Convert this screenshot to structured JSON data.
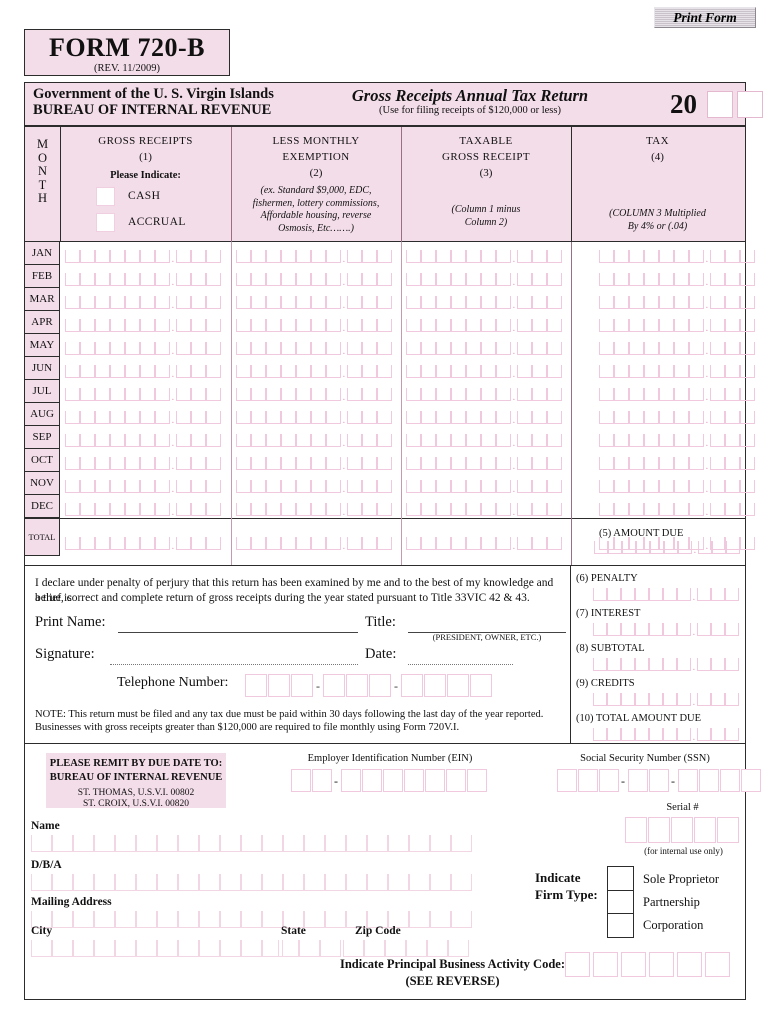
{
  "print_button": {
    "label": "Print Form"
  },
  "form_header": {
    "form_number": "FORM 720-B",
    "revision": "(REV. 11/2009)",
    "government_line": "Government of the U. S.  Virgin Islands",
    "bureau_line": "BUREAU OF INTERNAL REVENUE",
    "return_title": "Gross Receipts Annual Tax Return",
    "return_subtitle": "(Use for filing receipts of $120,000 or less)",
    "year_prefix": "20"
  },
  "columns": {
    "month_header": "M\nO\nN\nT\nH",
    "month_letters": [
      "M",
      "O",
      "N",
      "T",
      "H"
    ],
    "col1": {
      "title": "GROSS RECEIPTS",
      "number": "(1)",
      "please_indicate": "Please Indicate:",
      "options": [
        "CASH",
        "ACCRUAL"
      ]
    },
    "col2": {
      "title_line1": "LESS MONTHLY",
      "title_line2": "EXEMPTION",
      "number": "(2)",
      "note": "(ex. Standard $9,000, EDC, fishermen, lottery commissions, Affordable housing, reverse Osmosis, Etc…….)",
      "note_lines": [
        "(ex. Standard $9,000, EDC,",
        "fishermen, lottery commissions,",
        "Affordable housing, reverse",
        "Osmosis, Etc…….)"
      ]
    },
    "col3": {
      "title_line1": "TAXABLE",
      "title_line2": "GROSS RECEIPT",
      "number": "(3)",
      "note_lines": [
        "(Column 1 minus",
        "Column 2)"
      ]
    },
    "col4": {
      "title": "TAX",
      "number": "(4)",
      "note_lines": [
        "(COLUMN 3 Multiplied",
        "By  4% or (.04)"
      ]
    }
  },
  "months": [
    "JAN",
    "FEB",
    "MAR",
    "APR",
    "MAY",
    "JUN",
    "JUL",
    "AUG",
    "SEP",
    "OCT",
    "NOV",
    "DEC"
  ],
  "total_label": "TOTAL",
  "side_items": [
    {
      "label": "(5) AMOUNT DUE"
    },
    {
      "label": "(6) PENALTY"
    },
    {
      "label": "(7) INTEREST"
    },
    {
      "label": "(8) SUBTOTAL"
    },
    {
      "label": "(9) CREDITS"
    },
    {
      "label": "(10) TOTAL AMOUNT DUE"
    }
  ],
  "declaration": {
    "line1": "I declare under penalty of perjury that this return has been examined by me and to the best of my knowledge and belief is",
    "line2": "a true, correct and complete return of gross receipts during the year stated pursuant to Title 33VIC 42 & 43.",
    "print_name_label": "Print Name:",
    "title_label": "Title:",
    "title_hint": "(PRESIDENT, OWNER, ETC.)",
    "signature_label": "Signature:",
    "date_label": "Date:",
    "telephone_label": "Telephone Number:",
    "note_line1": "NOTE: This return must be filed and any tax due must be paid within 30 days following the last day of the year reported.",
    "note_line2": "Businesses with gross receipts greater than $120,000 are required to file monthly using Form 720V.I."
  },
  "remit": {
    "line1": "PLEASE REMIT BY DUE DATE TO:",
    "line2": "BUREAU OF INTERNAL REVENUE",
    "line3": "ST. THOMAS, U.S.V.I. 00802",
    "line4": "ST. CROIX, U.S.V.I.  00820"
  },
  "identifiers": {
    "ein_label": "Employer Identification Number (EIN)",
    "ssn_label": "Social Security Number (SSN)",
    "serial_label": "Serial #",
    "serial_note": "(for internal use only)"
  },
  "address_fields": {
    "name": "Name",
    "dba": "D/B/A",
    "mailing_address": "Mailing Address",
    "city": "City",
    "state": "State",
    "zip": "Zip Code"
  },
  "firm_type": {
    "label_line1": "Indicate",
    "label_line2": "Firm Type:",
    "options": [
      "Sole Proprietor",
      "Partnership",
      "Corporation"
    ]
  },
  "activity_code": {
    "label_line1": "Indicate Principal Business Activity Code:",
    "label_line2": "(SEE REVERSE)"
  },
  "colors": {
    "pink_fill": "#f3dde9",
    "pink_border": "#f0c9de",
    "dark_border": "#2c2c2c",
    "button_bg": "#c9c2cb"
  }
}
